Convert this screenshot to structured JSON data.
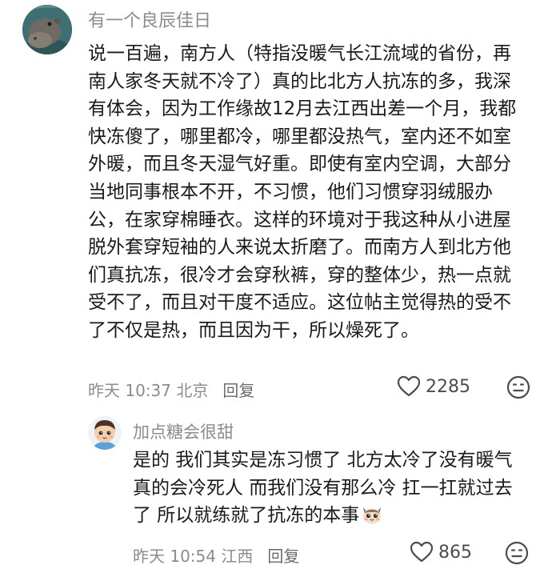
{
  "main_comment": {
    "username": "有一个良辰佳日",
    "lines": [
      "说一百遍，南方人（特指没暖气长江流域的省份，再",
      "南人家冬天就不冷了）真的比北方人抗冻的多，我深",
      "有体会，因为工作缘故12月去江西出差一个月，我都",
      "快冻傻了，哪里都冷，哪里都没热气，室内还不如室",
      "外暖，而且冬天湿气好重。即使有室内空调，大部分",
      "当地同事根本不开，不习惯，他们习惯穿羽绒服办",
      "公，在家穿棉睡衣。这样的环境对于我这种从小进屋",
      "脱外套穿短袖的人来说太折磨了。而南方人到北方他",
      "们真抗冻，很冷才会穿秋裤，穿的整体少，热一点就",
      "受不了，而且对干度不适应。这位帖主觉得热的受不",
      "了不仅是热，而且因为干，所以燥死了。"
    ],
    "time": "昨天 10:37 北京",
    "reply_label": "回复",
    "like_count": "2285",
    "avatar_icon": "hippo-avatar",
    "like_icon": "heart-outline-icon",
    "dislike_icon": "meh-face-icon"
  },
  "reply_comment": {
    "username": "加点糖会很甜",
    "lines": [
      "是的 我们其实是冻习惯了 北方太冷了没有暖气",
      "真的会冷死人 而我们没有那么冷 扛一扛就过去",
      "了 所以就练就了抗冻的本事"
    ],
    "time": "昨天 10:54 江西",
    "reply_label": "回复",
    "like_count": "865",
    "avatar_icon": "cartoon-boy-avatar",
    "inline_emoji": "cat-emoji-icon",
    "like_icon": "heart-outline-icon",
    "dislike_icon": "meh-face-icon"
  },
  "colors": {
    "username": "#8c8c8c",
    "body": "#1a1a1a",
    "meta": "#8c8c8c"
  }
}
